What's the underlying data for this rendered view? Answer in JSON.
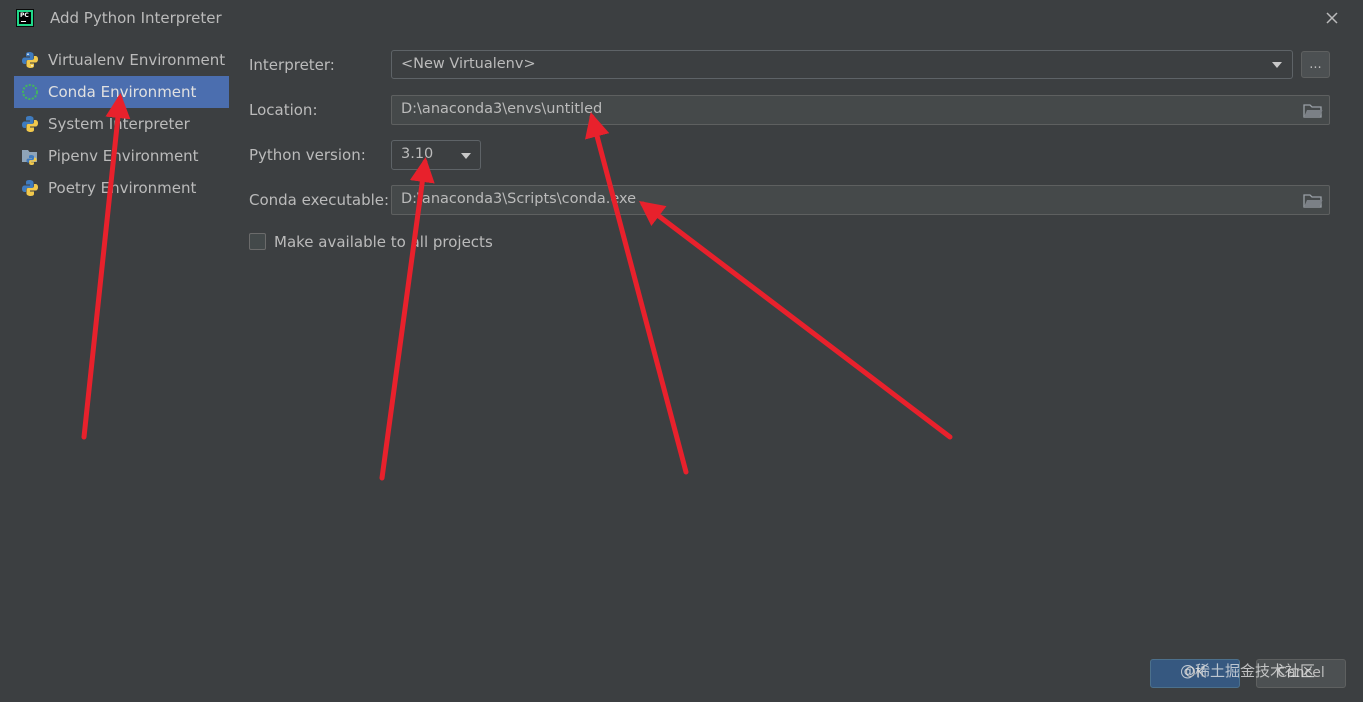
{
  "window": {
    "title": "Add Python Interpreter",
    "app_icon": "pycharm-icon",
    "close_icon": "close-icon"
  },
  "sidebar": {
    "items": [
      {
        "label": "Virtualenv Environment",
        "icon": "python-icon",
        "active": false
      },
      {
        "label": "Conda Environment",
        "icon": "conda-icon",
        "active": true
      },
      {
        "label": "System Interpreter",
        "icon": "python-icon",
        "active": false
      },
      {
        "label": "Pipenv Environment",
        "icon": "pipenv-icon",
        "active": false
      },
      {
        "label": "Poetry Environment",
        "icon": "python-icon",
        "active": false
      }
    ]
  },
  "form": {
    "interpreter": {
      "label": "Interpreter:",
      "value": "<New Virtualenv>",
      "browse_label": "..."
    },
    "location": {
      "label": "Location:",
      "value": "D:\\anaconda3\\envs\\untitled"
    },
    "python_version": {
      "label": "Python version:",
      "value": "3.10"
    },
    "conda_executable": {
      "label": "Conda executable:",
      "value": "D:\\anaconda3\\Scripts\\conda.exe"
    },
    "make_available": {
      "label": "Make available to all projects",
      "checked": false
    }
  },
  "buttons": {
    "ok": "OK",
    "cancel": "Cancel"
  },
  "watermark": "@稀土掘金技术社区",
  "colors": {
    "background": "#3c3f41",
    "selection": "#4b6eaf",
    "annotation_arrow": "#e8212c"
  }
}
